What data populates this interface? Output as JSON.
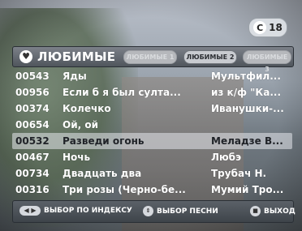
{
  "counter": {
    "label": "18"
  },
  "header": {
    "title": "ЛЮБИМЫЕ"
  },
  "tabs": [
    {
      "label": "ЛЮБИМЫЕ 1"
    },
    {
      "label": "ЛЮБИМЫЕ 2"
    },
    {
      "label": "ЛЮБИМЫЕ 3"
    }
  ],
  "songs": [
    {
      "code": "00543",
      "title": "Яды",
      "artist": "Мультфил..."
    },
    {
      "code": "00956",
      "title": "Если б я был султа...",
      "artist": "из к/ф \"Ка..."
    },
    {
      "code": "00374",
      "title": "Колечко",
      "artist": "Иванушки-..."
    },
    {
      "code": "00654",
      "title": "Ой, ой",
      "artist": ""
    },
    {
      "code": "00532",
      "title": "Разведи огонь",
      "artist": "Меладзе В..."
    },
    {
      "code": "00467",
      "title": "Ночь",
      "artist": "Любэ"
    },
    {
      "code": "00734",
      "title": "Двадцать два",
      "artist": "Трубач Н."
    },
    {
      "code": "00316",
      "title": "Три розы (Черно-бе...",
      "artist": "Мумий Тро..."
    }
  ],
  "footer": {
    "index_label": "ВЫБОР ПО ИНДЕКСУ",
    "song_label": "ВЫБОР ПЕСНИ",
    "exit_label": "ВЫХОД"
  },
  "icons": {
    "heart": "heart-icon",
    "left_right": "left-right-arrows-icon",
    "up_down": "up-down-arrows-icon",
    "stop": "stop-icon"
  }
}
